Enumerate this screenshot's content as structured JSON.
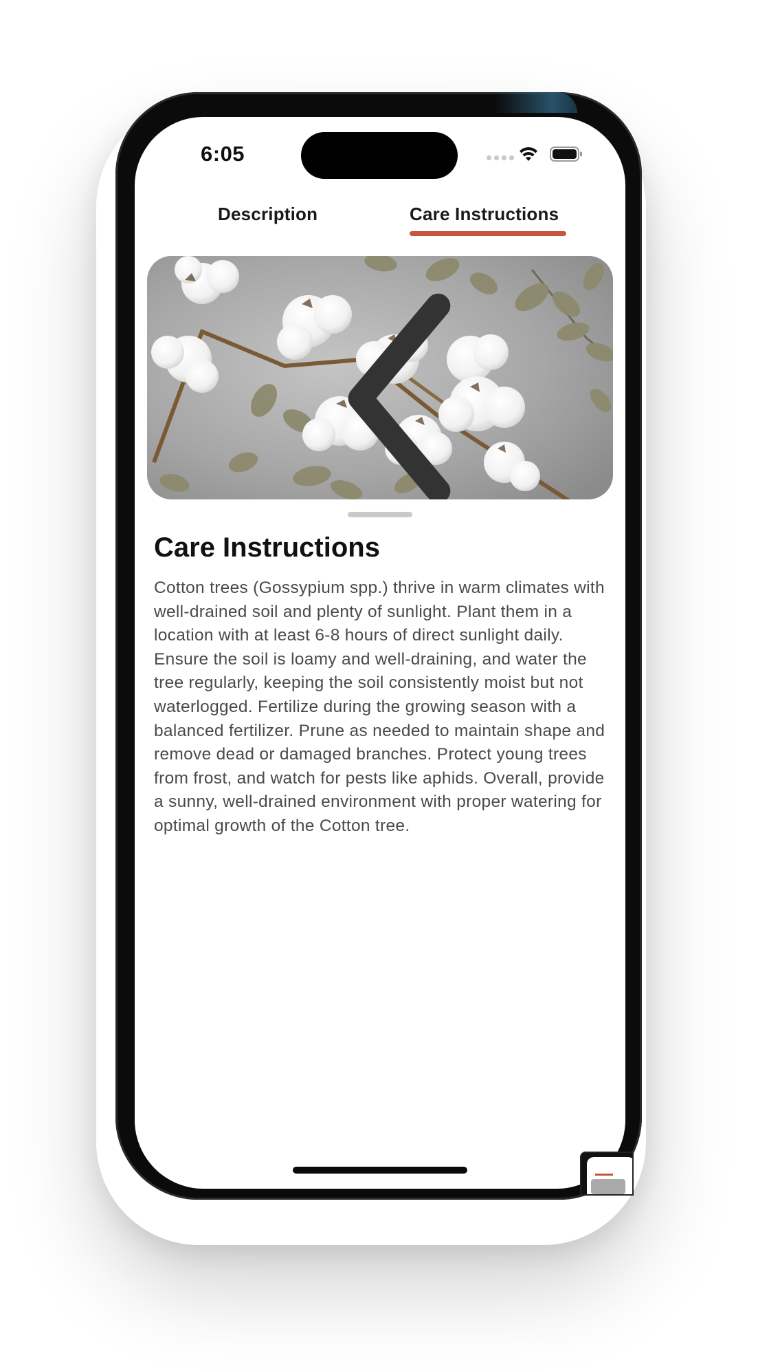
{
  "status_bar": {
    "time": "6:05"
  },
  "tabs": [
    {
      "label": "Description",
      "selected": false
    },
    {
      "label": "Care Instructions",
      "selected": true
    }
  ],
  "accent_color": "#c8553d",
  "hero_image": {
    "subject": "cotton bolls and eucalyptus leaves on grey concrete"
  },
  "content": {
    "title": "Care Instructions",
    "body": "Cotton trees (Gossypium spp.) thrive in warm climates with well-drained soil and plenty of sunlight. Plant them in a location with at least 6-8 hours of direct sunlight daily. Ensure the soil is loamy and well-draining, and water the tree regularly, keeping the soil consistently moist but not waterlogged. Fertilize during the growing season with a balanced fertilizer. Prune as needed to maintain shape and remove dead or damaged branches. Protect young trees from frost, and watch for pests like aphids. Overall, provide a sunny, well-drained environment with proper watering for optimal growth of the Cotton tree."
  },
  "icons": [
    "back-chevron-icon",
    "wifi-icon",
    "battery-icon",
    "cellular-signal-icon"
  ]
}
